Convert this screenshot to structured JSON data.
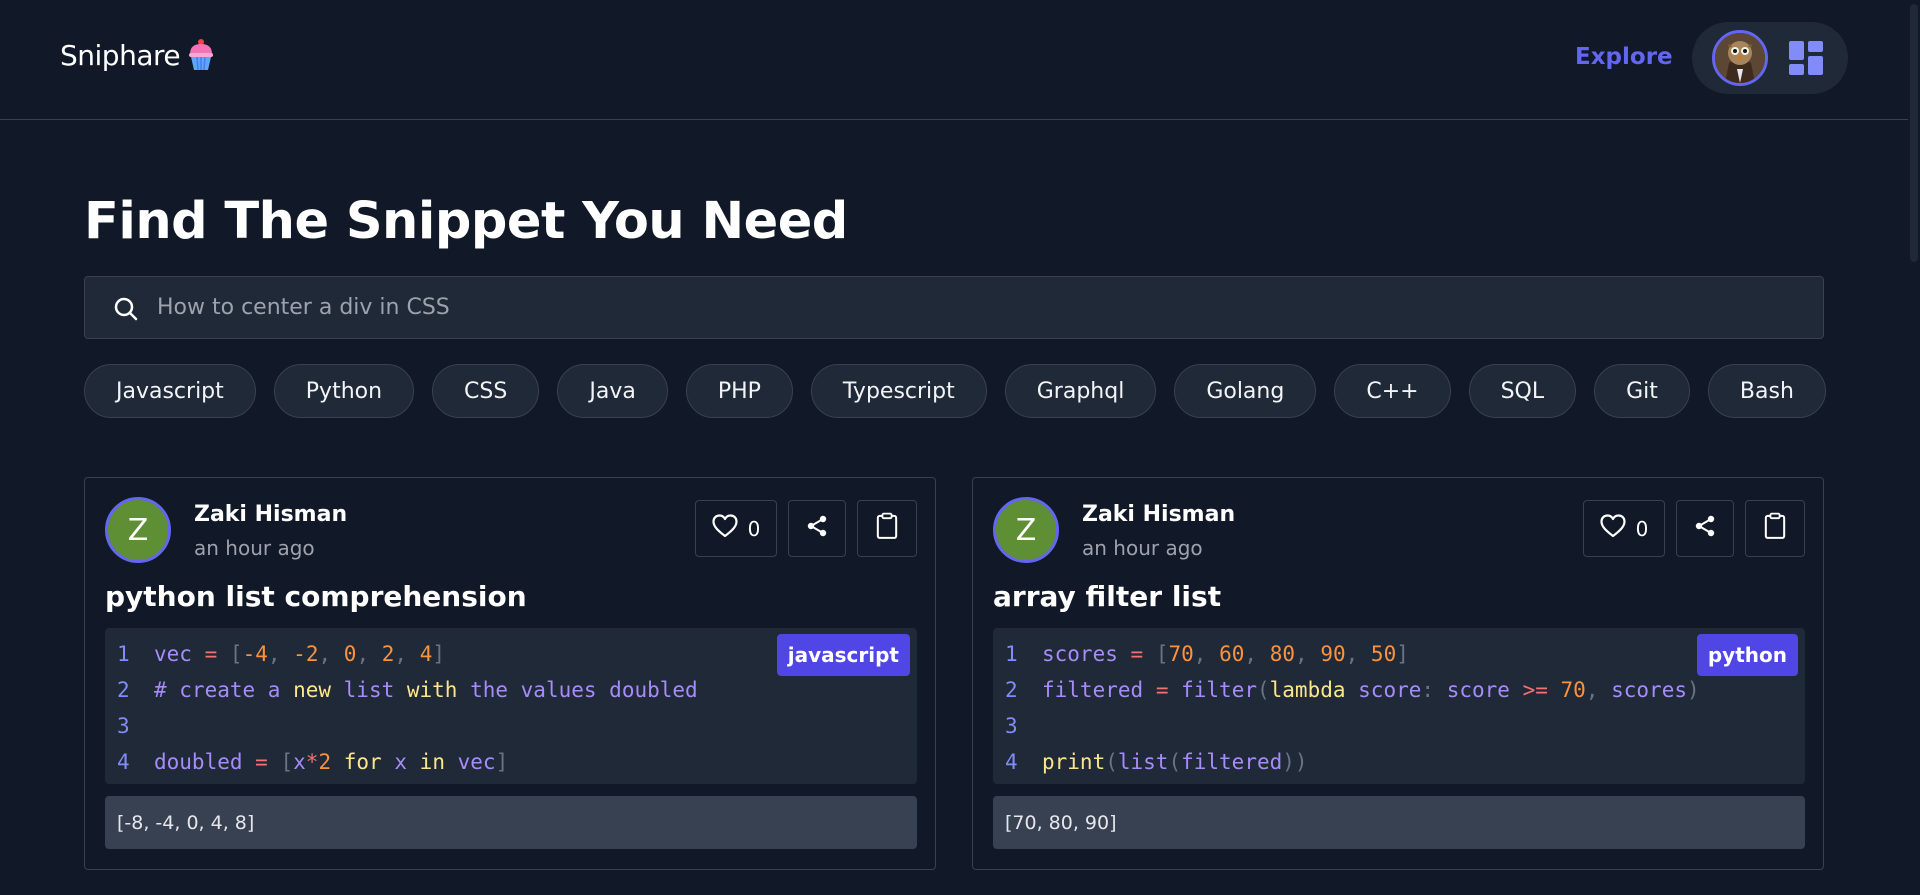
{
  "header": {
    "logo_text": "Sniphare",
    "logo_icon": "cupcake-icon",
    "explore_label": "Explore",
    "user_icon": "owl-avatar",
    "menu_icon": "grid-icon"
  },
  "main": {
    "title": "Find The Snippet You Need",
    "search": {
      "placeholder": "How to center a div in CSS",
      "value": "",
      "icon": "search-icon"
    },
    "languages": [
      "Javascript",
      "Python",
      "CSS",
      "Java",
      "PHP",
      "Typescript",
      "Graphql",
      "Golang",
      "C++",
      "SQL",
      "Git",
      "Bash"
    ]
  },
  "colors": {
    "background": "#111827",
    "surface": "#1f2937",
    "accent": "#6366f1",
    "badge": "#4f46e5",
    "avatar": "#5f8f34"
  },
  "snippets": [
    {
      "author_initial": "Z",
      "author": "Zaki Hisman",
      "time": "an hour ago",
      "likes": "0",
      "title": "python list comprehension",
      "language": "javascript",
      "output": "[-8, -4, 0, 4, 8]",
      "code": [
        {
          "n": "1",
          "tokens": [
            [
              "id",
              "vec"
            ],
            [
              "sp",
              " "
            ],
            [
              "op",
              "="
            ],
            [
              "sp",
              " "
            ],
            [
              "punc",
              "["
            ],
            [
              "num",
              "-4"
            ],
            [
              "punc",
              ","
            ],
            [
              "sp",
              " "
            ],
            [
              "num",
              "-2"
            ],
            [
              "punc",
              ","
            ],
            [
              "sp",
              " "
            ],
            [
              "num",
              "0"
            ],
            [
              "punc",
              ","
            ],
            [
              "sp",
              " "
            ],
            [
              "num",
              "2"
            ],
            [
              "punc",
              ","
            ],
            [
              "sp",
              " "
            ],
            [
              "num",
              "4"
            ],
            [
              "punc",
              "]"
            ]
          ]
        },
        {
          "n": "2",
          "tokens": [
            [
              "cm",
              "# create a "
            ],
            [
              "kw",
              "new"
            ],
            [
              "cm",
              " list "
            ],
            [
              "kw",
              "with"
            ],
            [
              "cm",
              " the values doubled"
            ]
          ]
        },
        {
          "n": "3",
          "tokens": []
        },
        {
          "n": "4",
          "tokens": [
            [
              "id",
              "doubled"
            ],
            [
              "sp",
              " "
            ],
            [
              "op",
              "="
            ],
            [
              "sp",
              " "
            ],
            [
              "punc",
              "["
            ],
            [
              "id",
              "x"
            ],
            [
              "op",
              "*"
            ],
            [
              "num",
              "2"
            ],
            [
              "sp",
              " "
            ],
            [
              "kw",
              "for"
            ],
            [
              "sp",
              " "
            ],
            [
              "id",
              "x"
            ],
            [
              "sp",
              " "
            ],
            [
              "kw",
              "in"
            ],
            [
              "sp",
              " "
            ],
            [
              "id",
              "vec"
            ],
            [
              "punc",
              "]"
            ]
          ]
        }
      ]
    },
    {
      "author_initial": "Z",
      "author": "Zaki Hisman",
      "time": "an hour ago",
      "likes": "0",
      "title": "array filter list",
      "language": "python",
      "output": "[70, 80, 90]",
      "code": [
        {
          "n": "1",
          "tokens": [
            [
              "id",
              "scores"
            ],
            [
              "sp",
              " "
            ],
            [
              "op",
              "="
            ],
            [
              "sp",
              " "
            ],
            [
              "punc",
              "["
            ],
            [
              "num",
              "70"
            ],
            [
              "punc",
              ","
            ],
            [
              "sp",
              " "
            ],
            [
              "num",
              "60"
            ],
            [
              "punc",
              ","
            ],
            [
              "sp",
              " "
            ],
            [
              "num",
              "80"
            ],
            [
              "punc",
              ","
            ],
            [
              "sp",
              " "
            ],
            [
              "num",
              "90"
            ],
            [
              "punc",
              ","
            ],
            [
              "sp",
              " "
            ],
            [
              "num",
              "50"
            ],
            [
              "punc",
              "]"
            ]
          ]
        },
        {
          "n": "2",
          "tokens": [
            [
              "id",
              "filtered"
            ],
            [
              "sp",
              " "
            ],
            [
              "op",
              "="
            ],
            [
              "sp",
              " "
            ],
            [
              "id",
              "filter"
            ],
            [
              "punc",
              "("
            ],
            [
              "kw",
              "lambda"
            ],
            [
              "sp",
              " "
            ],
            [
              "id",
              "score"
            ],
            [
              "punc",
              ":"
            ],
            [
              "sp",
              " "
            ],
            [
              "id",
              "score"
            ],
            [
              "sp",
              " "
            ],
            [
              "op",
              ">="
            ],
            [
              "sp",
              " "
            ],
            [
              "num",
              "70"
            ],
            [
              "punc",
              ","
            ],
            [
              "sp",
              " "
            ],
            [
              "id",
              "scores"
            ],
            [
              "punc",
              ")"
            ]
          ]
        },
        {
          "n": "3",
          "tokens": []
        },
        {
          "n": "4",
          "tokens": [
            [
              "fn",
              "print"
            ],
            [
              "punc",
              "("
            ],
            [
              "id",
              "list"
            ],
            [
              "punc",
              "("
            ],
            [
              "id",
              "filtered"
            ],
            [
              "punc",
              "))"
            ]
          ]
        }
      ]
    }
  ]
}
